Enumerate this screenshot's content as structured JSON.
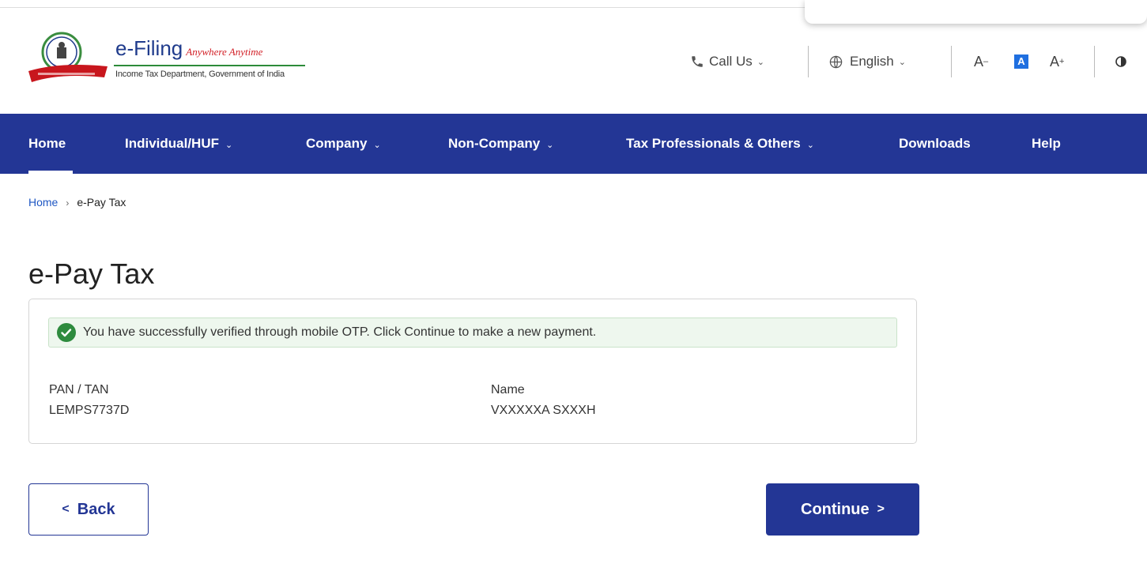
{
  "header": {
    "brand_title": "e-Filing",
    "brand_tagline": "Anywhere Anytime",
    "brand_subtitle": "Income Tax Department, Government of India",
    "call_us_label": "Call Us",
    "language_label": "English",
    "font_decrease_label": "A",
    "font_default_label": "A",
    "font_increase_label": "A"
  },
  "nav": {
    "items": [
      {
        "label": "Home"
      },
      {
        "label": "Individual/HUF"
      },
      {
        "label": "Company"
      },
      {
        "label": "Non-Company"
      },
      {
        "label": "Tax Professionals & Others"
      },
      {
        "label": "Downloads"
      },
      {
        "label": "Help"
      }
    ]
  },
  "breadcrumb": {
    "home": "Home",
    "current": "e-Pay Tax"
  },
  "page": {
    "title": "e-Pay Tax",
    "success_message": "You have successfully verified through mobile OTP. Click Continue to make a new payment.",
    "pan_label": "PAN / TAN",
    "pan_value": "LEMPS7737D",
    "name_label": "Name",
    "name_value": "VXXXXXA SXXXH"
  },
  "actions": {
    "back_label": "Back",
    "continue_label": "Continue"
  },
  "colors": {
    "nav_bg": "#233695",
    "success_bg": "#eef7ee",
    "success_icon": "#2e8b3e",
    "link": "#1f57c3"
  }
}
